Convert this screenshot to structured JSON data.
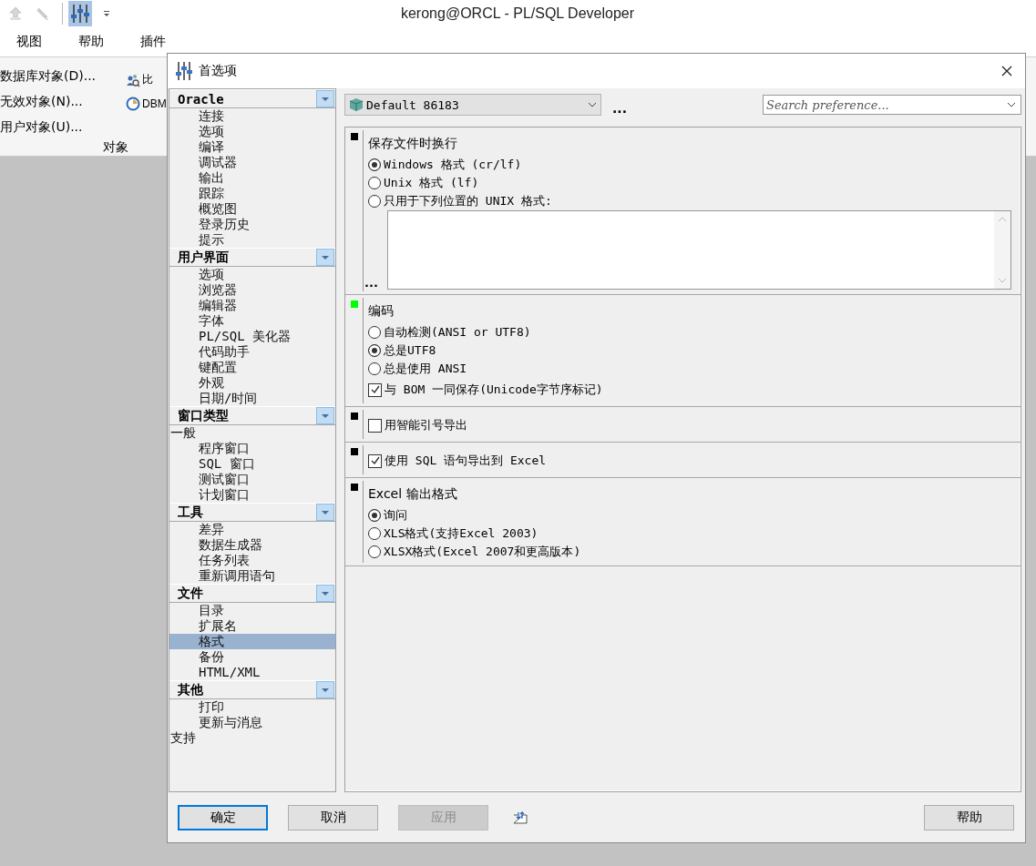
{
  "app": {
    "title": "kerong@ORCL - PL/SQL Developer",
    "menu": [
      {
        "label": "视图"
      },
      {
        "label": "帮助"
      },
      {
        "label": "插件"
      }
    ],
    "ribbon": {
      "commands": [
        {
          "label": "数据库对象(D)..."
        },
        {
          "label": "无效对象(N)..."
        },
        {
          "label": "用户对象(U)..."
        }
      ],
      "tools": [
        {
          "label": "比",
          "kind": "compare"
        },
        {
          "label": "DBM",
          "kind": "clock"
        }
      ],
      "group_label": "对象"
    }
  },
  "dialog": {
    "title": "首选项",
    "tree": [
      {
        "header": "Oracle",
        "items": [
          {
            "label": "连接",
            "kind": "item",
            "selected": false
          },
          {
            "label": "选项",
            "kind": "item",
            "selected": false
          },
          {
            "label": "编译",
            "kind": "item",
            "selected": false
          },
          {
            "label": "调试器",
            "kind": "item",
            "selected": false
          },
          {
            "label": "输出",
            "kind": "item",
            "selected": false
          },
          {
            "label": "跟踪",
            "kind": "item",
            "selected": false
          },
          {
            "label": "概览图",
            "kind": "item",
            "selected": false
          },
          {
            "label": "登录历史",
            "kind": "item",
            "selected": false
          },
          {
            "label": "提示",
            "kind": "item",
            "selected": false
          }
        ]
      },
      {
        "header": "用户界面",
        "items": [
          {
            "label": "选项",
            "kind": "item",
            "selected": false
          },
          {
            "label": "浏览器",
            "kind": "item",
            "selected": false
          },
          {
            "label": "编辑器",
            "kind": "item",
            "selected": false
          },
          {
            "label": "字体",
            "kind": "item",
            "selected": false
          },
          {
            "label": "PL/SQL 美化器",
            "kind": "item",
            "selected": false
          },
          {
            "label": "代码助手",
            "kind": "item",
            "selected": false
          },
          {
            "label": "键配置",
            "kind": "item",
            "selected": false
          },
          {
            "label": "外观",
            "kind": "item",
            "selected": false
          },
          {
            "label": "日期/时间",
            "kind": "item",
            "selected": false
          }
        ]
      },
      {
        "header": "窗口类型",
        "items": [
          {
            "label": "一般",
            "kind": "top",
            "selected": false
          },
          {
            "label": "程序窗口",
            "kind": "item",
            "selected": false
          },
          {
            "label": "SQL 窗口",
            "kind": "item",
            "selected": false
          },
          {
            "label": "测试窗口",
            "kind": "item",
            "selected": false
          },
          {
            "label": "计划窗口",
            "kind": "item",
            "selected": false
          }
        ]
      },
      {
        "header": "工具",
        "items": [
          {
            "label": "差异",
            "kind": "item",
            "selected": false
          },
          {
            "label": "数据生成器",
            "kind": "item",
            "selected": false
          },
          {
            "label": "任务列表",
            "kind": "item",
            "selected": false
          },
          {
            "label": "重新调用语句",
            "kind": "item",
            "selected": false
          }
        ]
      },
      {
        "header": "文件",
        "items": [
          {
            "label": "目录",
            "kind": "item",
            "selected": false
          },
          {
            "label": "扩展名",
            "kind": "item",
            "selected": false
          },
          {
            "label": "格式",
            "kind": "item",
            "selected": true
          },
          {
            "label": "备份",
            "kind": "item",
            "selected": false
          },
          {
            "label": "HTML/XML",
            "kind": "item",
            "selected": false
          }
        ]
      },
      {
        "header": "其他",
        "items": [
          {
            "label": "打印",
            "kind": "item",
            "selected": false
          },
          {
            "label": "更新与消息",
            "kind": "item",
            "selected": false
          },
          {
            "label": "支持",
            "kind": "top",
            "selected": false
          }
        ]
      }
    ],
    "profile": {
      "value": "Default 86183",
      "more": "..."
    },
    "search": {
      "placeholder": "Search preference..."
    },
    "sections": [
      {
        "kind": "group",
        "color": "#000000",
        "title": "保存文件时换行",
        "options": [
          {
            "kind": "radio",
            "label": "Windows 格式 (cr/lf)",
            "selected": true
          },
          {
            "kind": "radio",
            "label": "Unix 格式 (lf)",
            "selected": false
          },
          {
            "kind": "radio",
            "label": "只用于下列位置的 UNIX 格式:",
            "selected": false
          },
          {
            "kind": "textarea",
            "more": "..."
          }
        ]
      },
      {
        "kind": "group",
        "color": "#00ff00",
        "title": "编码",
        "options": [
          {
            "kind": "radio",
            "label": "自动检测(ANSI or UTF8)",
            "selected": false
          },
          {
            "kind": "radio",
            "label": "总是UTF8",
            "selected": true
          },
          {
            "kind": "radio",
            "label": "总是使用 ANSI",
            "selected": false
          },
          {
            "kind": "checkbox",
            "label": "与 BOM 一同保存(Unicode字节序标记)",
            "checked": true
          }
        ]
      },
      {
        "kind": "group",
        "color": "#000000",
        "options": [
          {
            "kind": "checkbox",
            "label": "用智能引号导出",
            "checked": false
          }
        ]
      },
      {
        "kind": "group",
        "color": "#000000",
        "options": [
          {
            "kind": "checkbox",
            "label": "使用 SQL 语句导出到 Excel",
            "checked": true
          }
        ]
      },
      {
        "kind": "group",
        "color": "#000000",
        "title": "Excel 输出格式",
        "options": [
          {
            "kind": "radio",
            "label": "询问",
            "selected": true
          },
          {
            "kind": "radio",
            "label": "XLS格式(支持Excel 2003)",
            "selected": false
          },
          {
            "kind": "radio",
            "label": "XLSX格式(Excel 2007和更高版本)",
            "selected": false
          }
        ]
      }
    ],
    "buttons_left": [
      {
        "label": "确定",
        "default": true,
        "disabled": false
      },
      {
        "label": "取消",
        "default": false,
        "disabled": false
      },
      {
        "label": "应用",
        "default": false,
        "disabled": true
      }
    ],
    "buttons_right": [
      {
        "label": "帮助",
        "default": false,
        "disabled": false
      }
    ]
  }
}
